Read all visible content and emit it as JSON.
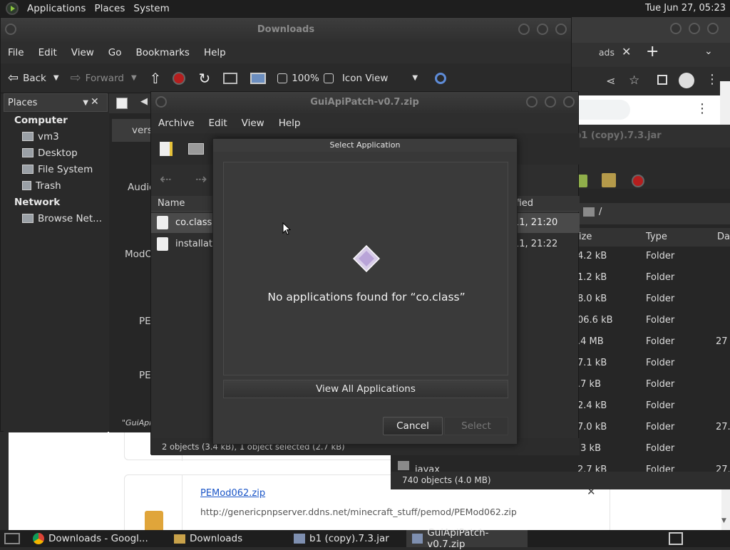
{
  "top_panel": {
    "menus": [
      "Applications",
      "Places",
      "System"
    ],
    "clock": "Tue Jun 27, 05:23"
  },
  "browser": {
    "tab_partial": "ads",
    "download_card": {
      "filename": "PEMod062.zip",
      "url": "http://genericpnpserver.ddns.net/minecraft_stuff/pemod/PEMod062.zip"
    }
  },
  "jar_window": {
    "title": "b1 (copy).7.3.jar",
    "path": "/",
    "columns": [
      "ize",
      "Type",
      "Da"
    ],
    "rows": [
      {
        "size": "4.2 kB",
        "type": "Folder",
        "date": ""
      },
      {
        "size": "1.2 kB",
        "type": "Folder",
        "date": ""
      },
      {
        "size": "8.0 kB",
        "type": "Folder",
        "date": ""
      },
      {
        "size": "06.6 kB",
        "type": "Folder",
        "date": ""
      },
      {
        "size": ".4 MB",
        "type": "Folder",
        "date": "27"
      },
      {
        "size": "7.1 kB",
        "type": "Folder",
        "date": ""
      },
      {
        "size": ".7 kB",
        "type": "Folder",
        "date": ""
      },
      {
        "size": "2.4 kB",
        "type": "Folder",
        "date": ""
      },
      {
        "size": "7.0 kB",
        "type": "Folder",
        "date": "27."
      },
      {
        "size": ".3 kB",
        "type": "Folder",
        "date": ""
      },
      {
        "size": "2.7 kB",
        "type": "Folder",
        "date": "27."
      }
    ],
    "partial_row_name": "javax",
    "status": "740 objects (4.0 MB)"
  },
  "downloads_window": {
    "title": "Downloads",
    "menus": [
      "File",
      "Edit",
      "View",
      "Go",
      "Bookmarks",
      "Help"
    ],
    "toolbar": {
      "back": "Back",
      "forward": "Forward",
      "zoom": "100%",
      "view_mode": "Icon View"
    },
    "sidebar": {
      "header": "Places",
      "sections": [
        {
          "title": "Computer",
          "items": [
            "vm3",
            "Desktop",
            "File System",
            "Trash"
          ]
        },
        {
          "title": "Network",
          "items": [
            "Browse Net..."
          ]
        }
      ]
    },
    "content_labels": [
      "versi",
      "Audio",
      "ModO",
      "PE",
      "PE"
    ],
    "status": "\"GuiApi"
  },
  "archive_window": {
    "title": "GuiApiPatch-v0.7.zip",
    "menus": [
      "Archive",
      "Edit",
      "View",
      "Help"
    ],
    "columns": {
      "name": "Name",
      "modified": "ified"
    },
    "files": [
      {
        "name": "co.class",
        "modified": "11, 21:20"
      },
      {
        "name": "installati",
        "modified": "11, 21:22"
      }
    ],
    "status": "2 objects (3.4 kB), 1 object selected (2.7 kB)"
  },
  "dialog": {
    "title": "Select Application",
    "message": "No applications found for “co.class”",
    "view_all": "View All Applications",
    "cancel": "Cancel",
    "select": "Select"
  },
  "taskbar": {
    "items": [
      "Downloads - Googl...",
      "Downloads",
      "b1 (copy).7.3.jar",
      "GuiApiPatch-v0.7.zip"
    ]
  }
}
